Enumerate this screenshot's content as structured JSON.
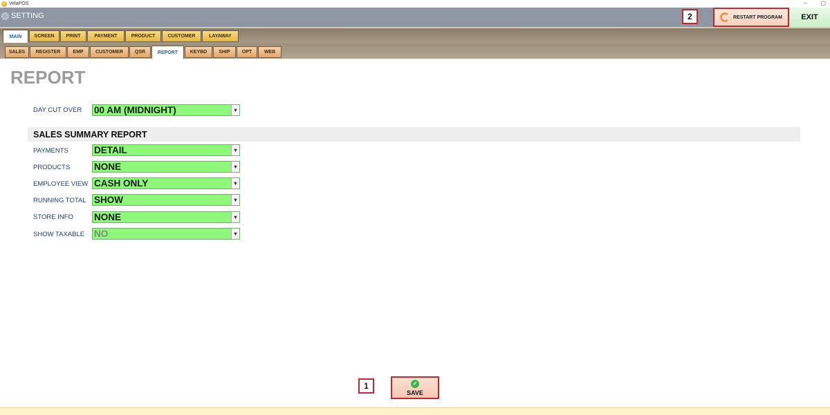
{
  "window": {
    "app_name": "VelaPOS",
    "minimize": "–",
    "maximize": "▢"
  },
  "header": {
    "title": "SETTING",
    "restart_label": "RESTART PROGRAM",
    "exit_label": "EXIT",
    "callout_restart": "2"
  },
  "main_tabs": [
    {
      "label": "MAIN",
      "active": true
    },
    {
      "label": "SCREEN"
    },
    {
      "label": "PRINT"
    },
    {
      "label": "PAYMENT"
    },
    {
      "label": "PRODUCT"
    },
    {
      "label": "CUSTOMER"
    },
    {
      "label": "LAYAWAY"
    }
  ],
  "sub_tabs": [
    {
      "label": "SALES"
    },
    {
      "label": "REGISTER"
    },
    {
      "label": "EMP"
    },
    {
      "label": "CUSTOMER"
    },
    {
      "label": "QSR"
    },
    {
      "label": "REPORT",
      "active": true
    },
    {
      "label": "KEYBD"
    },
    {
      "label": "SHIP"
    },
    {
      "label": "OPT"
    },
    {
      "label": "WEB"
    }
  ],
  "page": {
    "title": "REPORT",
    "day_cut_over": {
      "label": "DAY CUT OVER",
      "value": "00 AM (MIDNIGHT)"
    },
    "section_title": "SALES SUMMARY REPORT",
    "fields": [
      {
        "label": "PAYMENTS",
        "value": "DETAIL"
      },
      {
        "label": "PRODUCTS",
        "value": "NONE"
      },
      {
        "label": "EMPLOYEE VIEW",
        "value": "CASH ONLY"
      },
      {
        "label": "RUNNING TOTAL",
        "value": "SHOW"
      },
      {
        "label": "STORE INFO",
        "value": "NONE"
      },
      {
        "label": "SHOW TAXABLE",
        "value": "NO",
        "disabled": true
      }
    ]
  },
  "footer": {
    "save_label": "SAVE",
    "callout_save": "1"
  },
  "colors": {
    "header": "#8e97a3",
    "field_bg": "#8ef87a",
    "callout_border": "#c0282d",
    "label_text": "#1e3a70"
  }
}
